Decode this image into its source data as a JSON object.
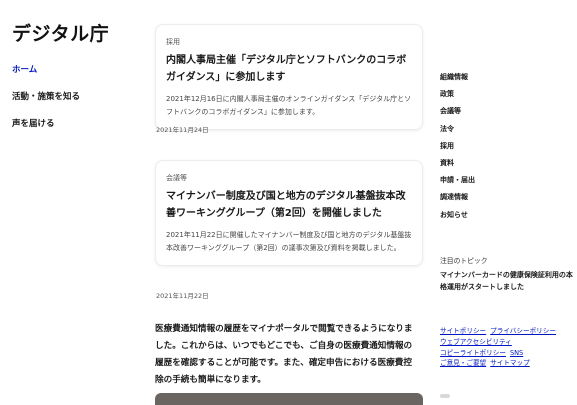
{
  "site": {
    "logo": "デジタル庁"
  },
  "leftnav": {
    "items": [
      {
        "label": "ホーム"
      },
      {
        "label": "活動・施策を知る"
      },
      {
        "label": "声を届ける"
      }
    ]
  },
  "news": [
    {
      "category": "採用",
      "title": "内閣人事局主催「デジタル庁とソフトバンクのコラボガイダンス」に参加します",
      "description": "2021年12月16日に内閣人事局主催のオンラインガイダンス「デジタル庁とソフトバンクのコラボガイダンス」に参加します。",
      "date": "2021年11月24日"
    },
    {
      "category": "会議等",
      "title": "マイナンバー制度及び国と地方のデジタル基盤抜本改善ワーキンググループ（第2回）を開催しました",
      "description": "2021年11月22日に開催したマイナンバー制度及び国と地方のデジタル基盤抜本改善ワーキンググループ（第2回）の議事次第及び資料を掲載しました。",
      "date": "2021年11月22日"
    }
  ],
  "body_text": "医療費通知情報の履歴をマイナポータルで閲覧できるようになりました。これからは、いつでもどこでも、ご自身の医療費通知情報の履歴を確認することが可能です。また、確定申告における医療費控除の手続も簡単になります。",
  "rightnav": {
    "items": [
      {
        "label": "組織情報"
      },
      {
        "label": "政策"
      },
      {
        "label": "会議等"
      },
      {
        "label": "法令"
      },
      {
        "label": "採用"
      },
      {
        "label": "資料"
      },
      {
        "label": "申請・届出"
      },
      {
        "label": "調達情報"
      },
      {
        "label": "お知らせ"
      }
    ]
  },
  "topics": {
    "heading": "注目のトピック",
    "link": "マイナンバーカードの健康保険証利用の本格運用がスタートしました"
  },
  "footer": {
    "links": [
      {
        "label": "サイトポリシー"
      },
      {
        "label": "プライバシーポリシー"
      },
      {
        "label": "ウェブアクセシビリティ"
      },
      {
        "label": "コピーライトポリシー"
      },
      {
        "label": "SNS"
      },
      {
        "label": "ご意見・ご要望"
      },
      {
        "label": "サイトマップ"
      }
    ]
  }
}
